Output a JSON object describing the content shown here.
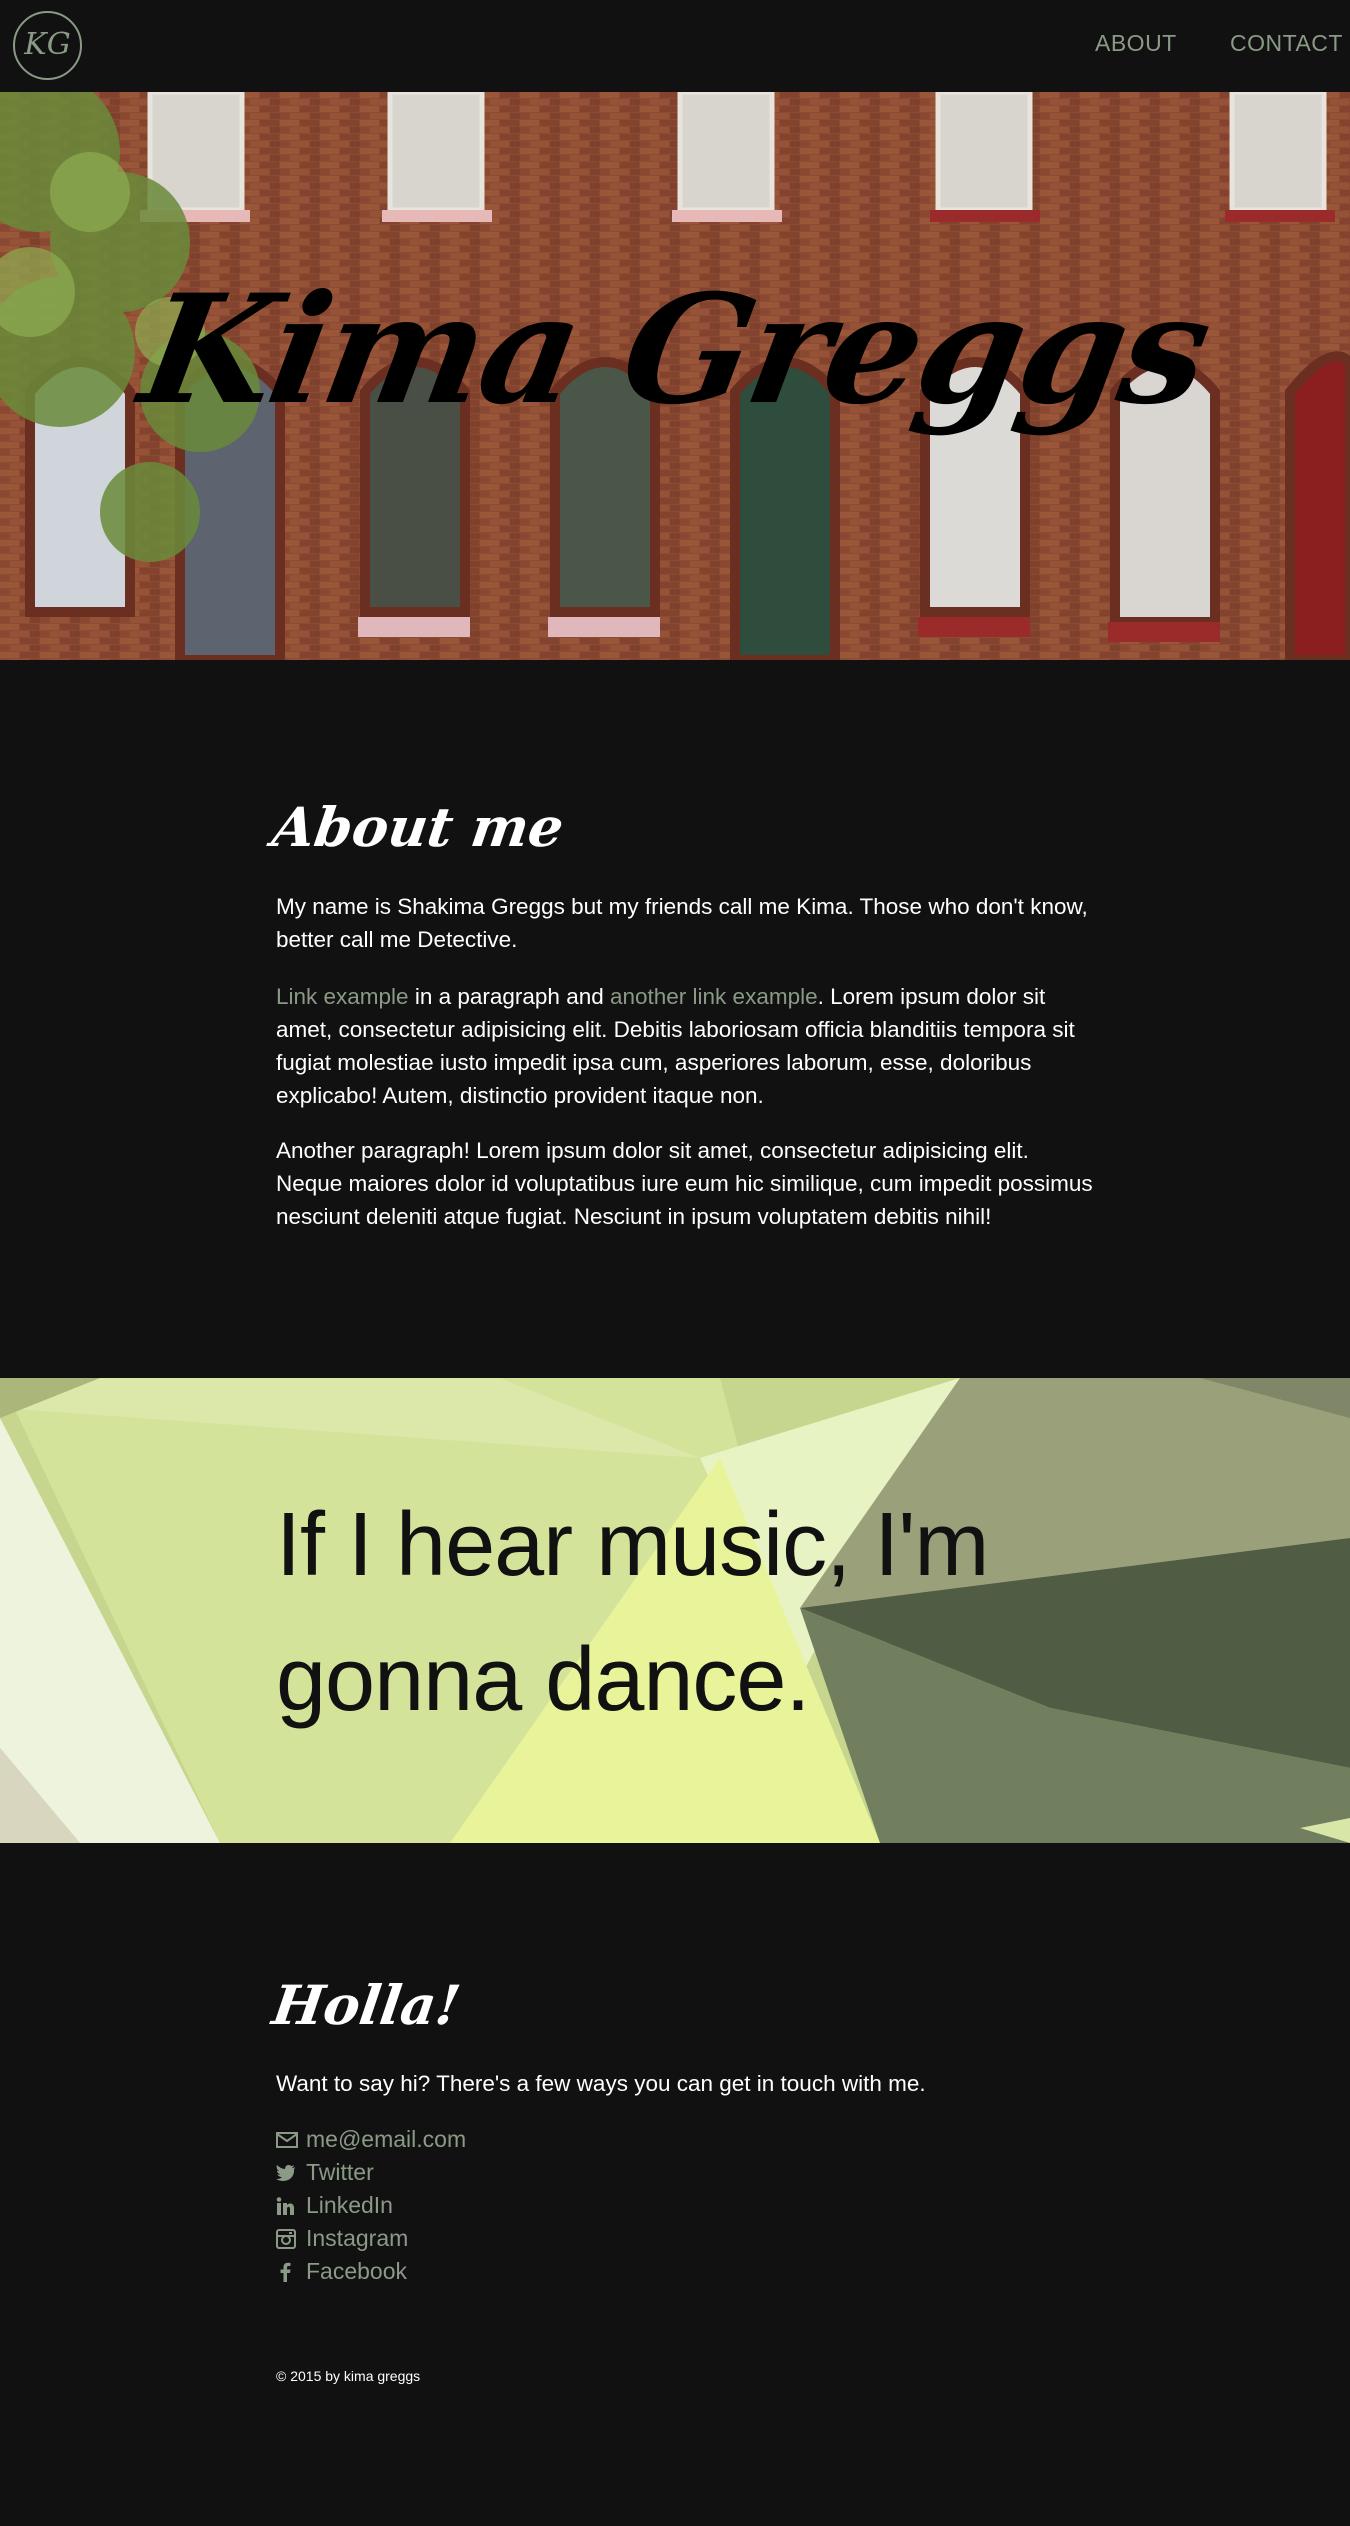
{
  "nav": {
    "logo_text": "KG",
    "links": [
      {
        "label": "ABOUT"
      },
      {
        "label": "CONTACT"
      }
    ],
    "accent_color": "#8a9a86"
  },
  "hero": {
    "title": "Kima Greggs"
  },
  "about": {
    "heading": "About me",
    "p1": "My name is Shakima Greggs but my friends call me Kima. Those who don't know, better call me Detective.",
    "p2": {
      "link1": "Link example",
      "text1": " in a paragraph and ",
      "link2": "another link example",
      "text2": ". Lorem ipsum dolor sit amet, consectetur adipisicing elit. Debitis laboriosam officia blanditiis tempora sit fugiat molestiae iusto impedit ipsa cum, asperiores laborum, esse, doloribus explicabo! Autem, distinctio provident itaque non."
    },
    "p3": "Another paragraph! Lorem ipsum dolor sit amet, consectetur adipisicing elit. Neque maiores dolor id voluptatibus iure eum hic similique, cum impedit possimus nesciunt deleniti atque fugiat. Nesciunt in ipsum voluptatem debitis nihil!"
  },
  "quote": {
    "text": "If I hear music, I'm gonna dance."
  },
  "contact": {
    "heading": "Holla!",
    "intro": "Want to say hi? There's a few ways you can get in touch with me.",
    "items": [
      {
        "icon": "envelope-icon",
        "label": "me@email.com"
      },
      {
        "icon": "twitter-icon",
        "label": "Twitter"
      },
      {
        "icon": "linkedin-icon",
        "label": "LinkedIn"
      },
      {
        "icon": "instagram-icon",
        "label": "Instagram"
      },
      {
        "icon": "facebook-icon",
        "label": "Facebook"
      }
    ]
  },
  "footer": {
    "text": "© 2015 by kima greggs"
  }
}
